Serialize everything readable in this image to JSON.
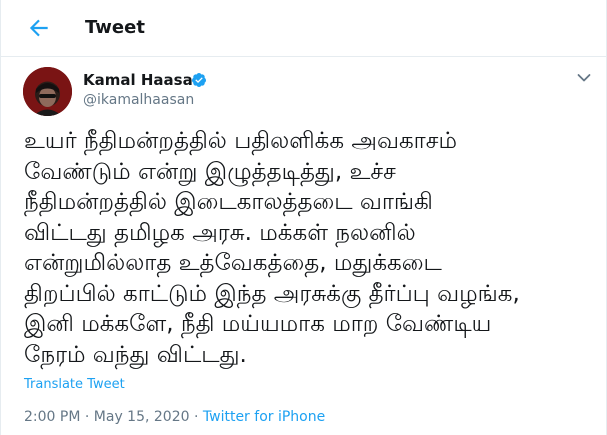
{
  "header": {
    "title": "Tweet",
    "back_icon": "arrow-left-icon"
  },
  "author": {
    "name": "Kamal Haasan",
    "handle": "@ikamalhaasan",
    "verified_icon": "verified-badge-icon",
    "more_icon": "chevron-down-icon"
  },
  "tweet": {
    "text": "உயர் நீதிமன்றத்தில் பதிலளிக்க அவகாசம்\nவேண்டும் என்று இழுத்தடித்து, உச்ச\nநீதிமன்றத்தில் இடைகாலத்தடை வாங்கி\nவிட்டது தமிழக அரசு. மக்கள் நலனில்\nஎன்றுமில்லாத உத்வேகத்தை, மதுக்கடை\nதிறப்பில் காட்டும் இந்த அரசுக்கு தீர்ப்பு வழங்க,\nஇனி மக்களே, நீதி மய்யமாக மாற வேண்டிய\nநேரம் வந்து விட்டது.",
    "translate_label": "Translate Tweet",
    "time": "2:00 PM",
    "separator": " · ",
    "date": "May 15, 2020",
    "source": "Twitter for iPhone"
  },
  "colors": {
    "accent": "#1da1f2",
    "secondary_text": "#657786",
    "primary_text": "#14171a",
    "border": "#e6ecf0"
  }
}
